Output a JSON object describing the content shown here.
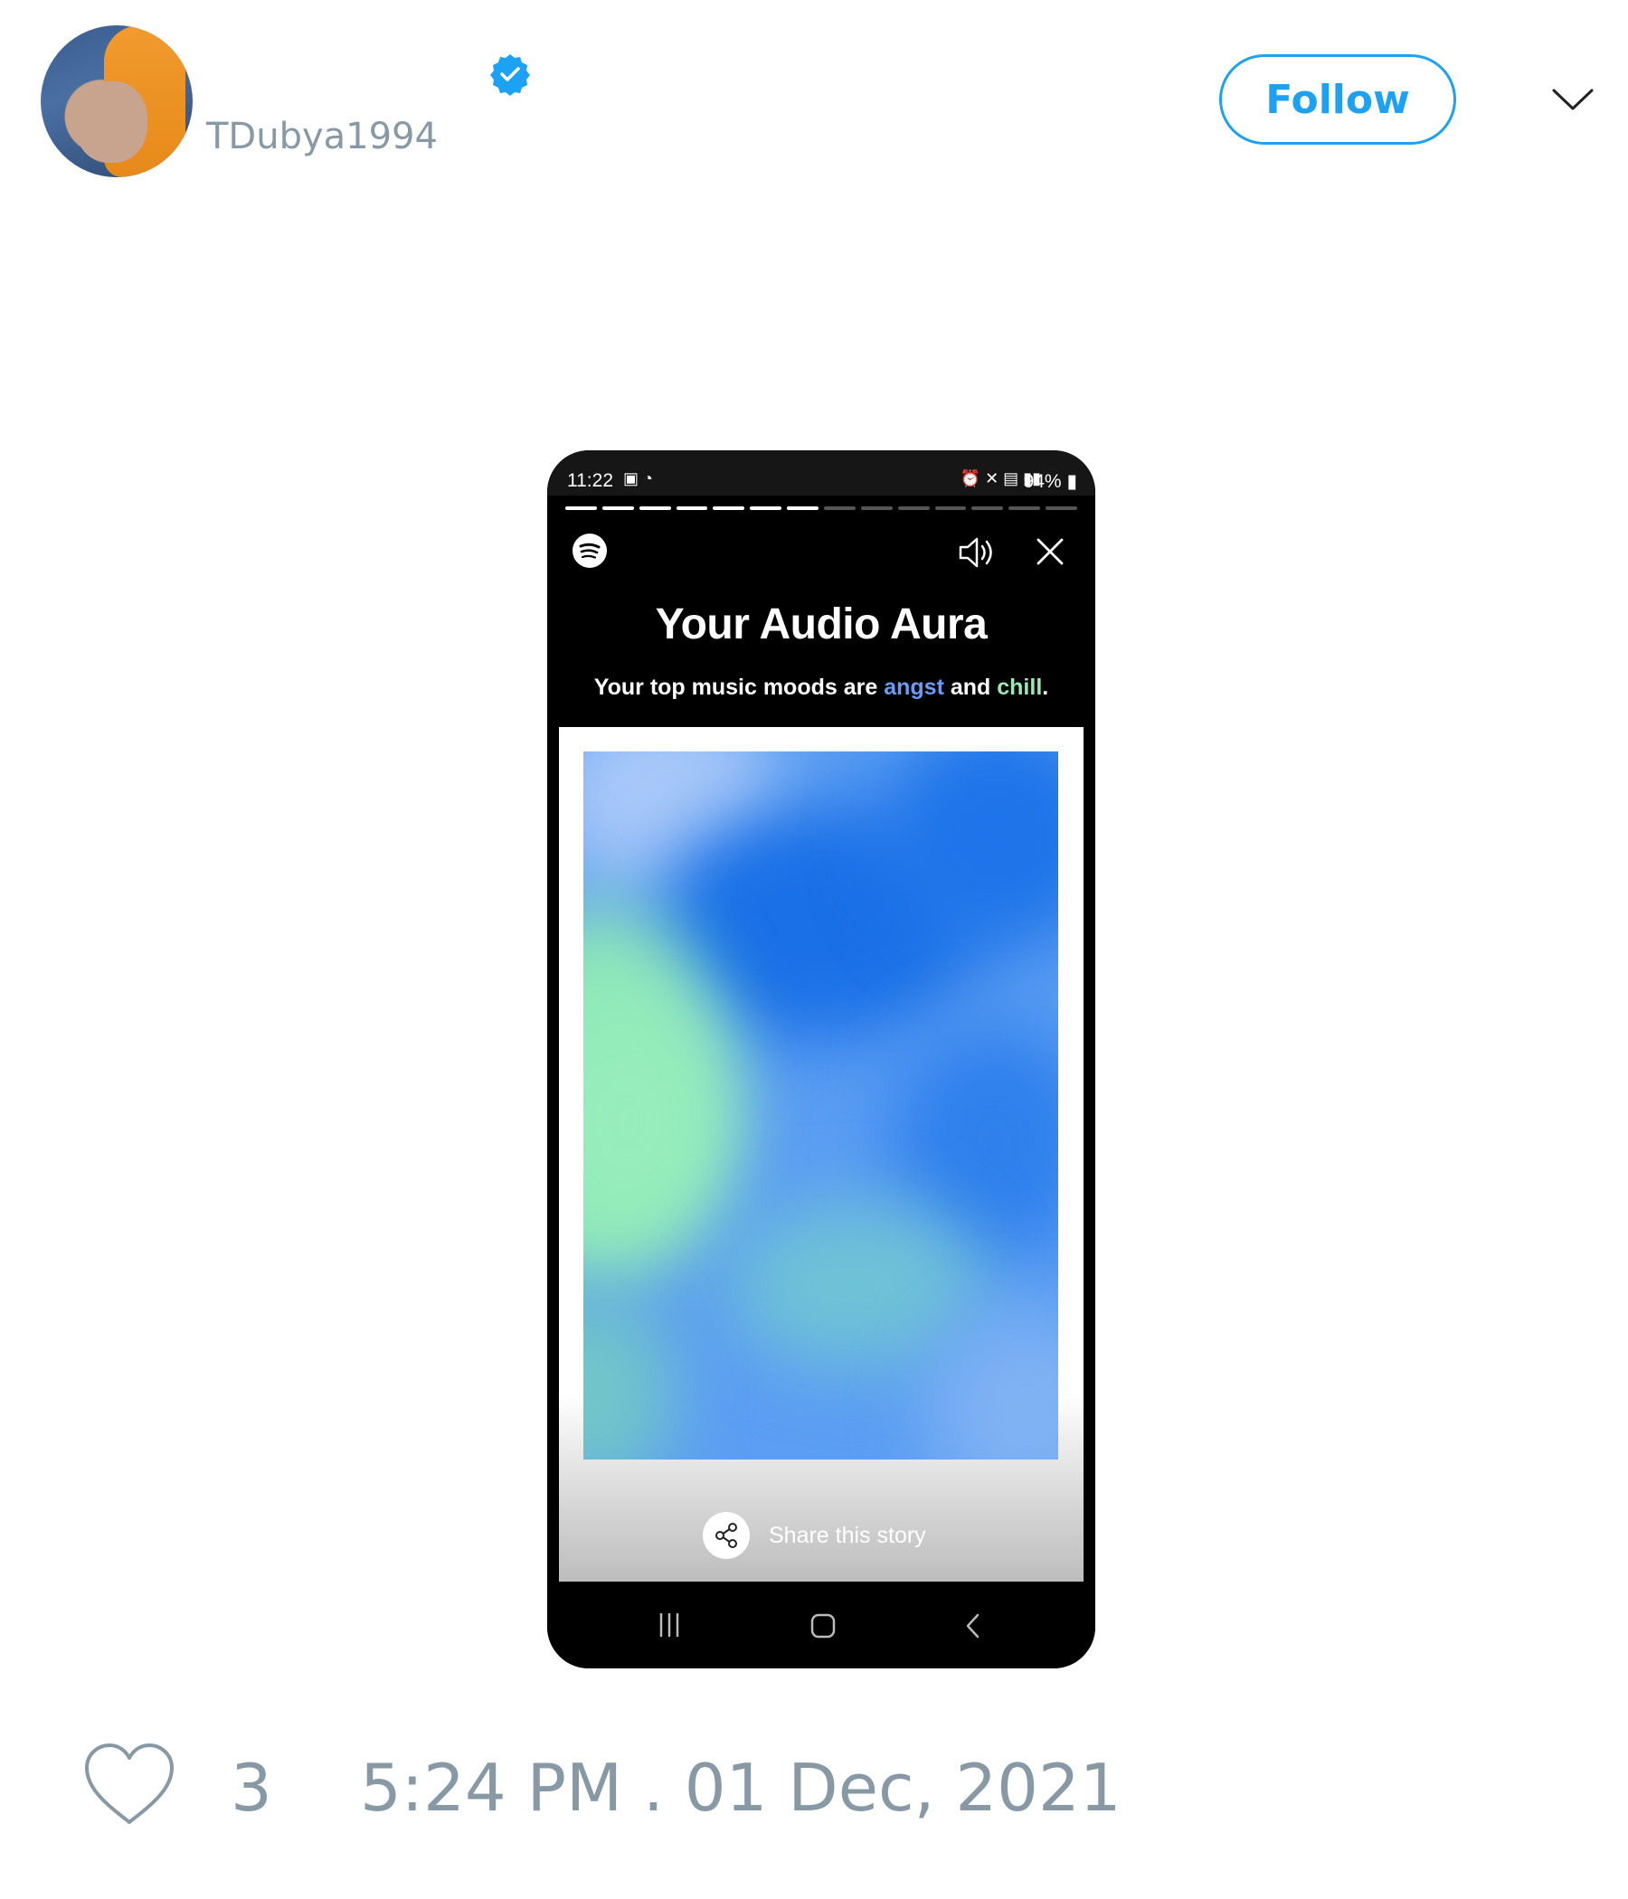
{
  "tweet": {
    "username": "TDubya1994",
    "follow_label": "Follow",
    "like_count": "3",
    "timestamp": "5:24 PM . 01 Dec, 2021"
  },
  "phone": {
    "status": {
      "time": "11:22",
      "battery": "94%"
    },
    "story": {
      "title": "Your Audio Aura",
      "subtitle_prefix": "Your top music moods are ",
      "mood_1": "angst",
      "subtitle_mid": " and ",
      "mood_2": "chill",
      "subtitle_suffix": ".",
      "share_label": "Share this story",
      "progress_total_segments": 14,
      "progress_completed_segments": 7
    }
  },
  "colors": {
    "twitter_blue": "#1da1f2",
    "muted_gray": "#8899a6",
    "angst": "#6a9cf5",
    "chill": "#9be8b4"
  }
}
